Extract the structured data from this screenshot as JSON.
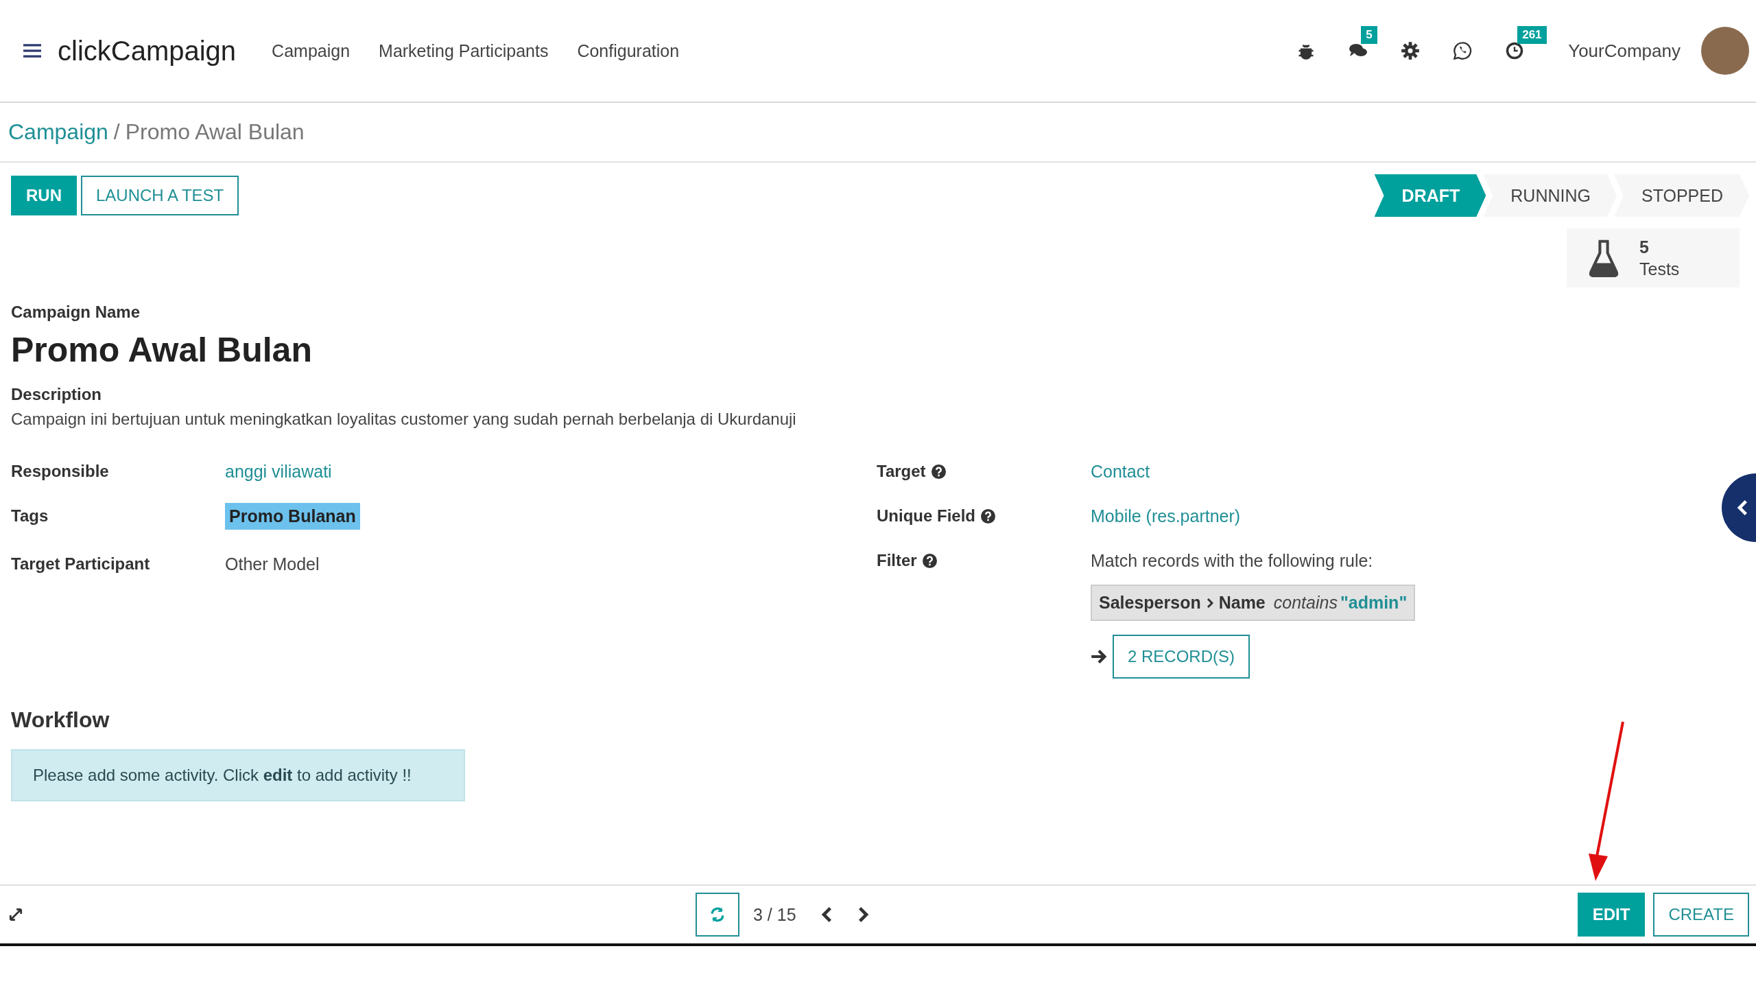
{
  "navbar": {
    "app_name": "clickCampaign",
    "menu": [
      "Campaign",
      "Marketing Participants",
      "Configuration"
    ],
    "messages_badge": "5",
    "activities_badge": "261",
    "company": "YourCompany"
  },
  "breadcrumb": {
    "parent": "Campaign",
    "separator": "/",
    "current": "Promo Awal Bulan"
  },
  "actions": [
    {
      "label": "RUN",
      "kind": "primary"
    },
    {
      "label": "LAUNCH A TEST",
      "kind": "secondary"
    }
  ],
  "stages": [
    {
      "label": "DRAFT",
      "selected": true
    },
    {
      "label": "RUNNING",
      "selected": false
    },
    {
      "label": "STOPPED",
      "selected": false
    }
  ],
  "smart_button": {
    "count": "5",
    "label": "Tests"
  },
  "form": {
    "name_label": "Campaign Name",
    "name": "Promo Awal Bulan",
    "description_label": "Description",
    "description": "Campaign ini bertujuan untuk meningkatkan loyalitas customer yang sudah pernah berbelanja di Ukurdanuji",
    "left_fields": [
      {
        "label": "Responsible",
        "value": "anggi viliawati",
        "kind": "link"
      },
      {
        "label": "Tags",
        "value": "Promo Bulanan",
        "kind": "tag"
      },
      {
        "label": "Target Participant",
        "value": "Other Model",
        "kind": "text"
      }
    ],
    "right_fields": [
      {
        "label": "Target",
        "value": "Contact",
        "kind": "link",
        "help": true
      },
      {
        "label": "Unique Field",
        "value": "Mobile (res.partner)",
        "kind": "link",
        "help": true
      },
      {
        "label": "Filter",
        "value": "Match records with the following rule:",
        "kind": "text",
        "help": true
      }
    ],
    "filter_rule": {
      "path": "Salesperson",
      "field": "Name",
      "operator": "contains",
      "value": "\"admin\""
    },
    "records_button": "2 RECORD(S)"
  },
  "workflow": {
    "title": "Workflow",
    "notice": "Please add some activity. Click **edit** to add activity !!"
  },
  "pager": {
    "text": "3 / 15"
  },
  "footer_buttons": [
    {
      "label": "EDIT",
      "kind": "primary"
    },
    {
      "label": "CREATE",
      "kind": "secondary"
    }
  ]
}
